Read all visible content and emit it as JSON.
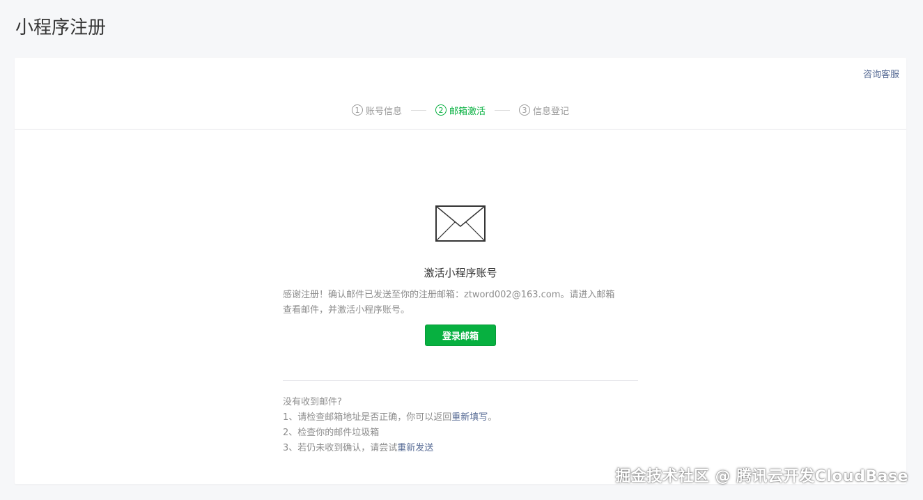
{
  "page": {
    "title": "小程序注册"
  },
  "header": {
    "support_link": "咨询客服"
  },
  "steps": [
    {
      "num": "1",
      "label": "账号信息",
      "active": false
    },
    {
      "num": "2",
      "label": "邮箱激活",
      "active": true
    },
    {
      "num": "3",
      "label": "信息登记",
      "active": false
    }
  ],
  "activation": {
    "title": "激活小程序账号",
    "desc_line1": "感谢注册！确认邮件已发送至你的注册邮箱：ztword002@163.com。请进入邮箱",
    "desc_line2": "查看邮件，并激活小程序账号。",
    "login_button": "登录邮箱"
  },
  "help": {
    "heading": "没有收到邮件?",
    "item1_prefix": "1、请检查邮箱地址是否正确，你可以返回",
    "item1_link": "重新填写",
    "item1_suffix": "。",
    "item2": "2、检查你的邮件垃圾箱",
    "item3_prefix": "3、若仍未收到确认，请尝试",
    "item3_link": "重新发送"
  },
  "watermark": "掘金技术社区 @ 腾讯云开发CloudBase",
  "colors": {
    "accent_green": "#07b040",
    "link_blue": "#576b95",
    "muted_text": "#8d8d8d"
  }
}
